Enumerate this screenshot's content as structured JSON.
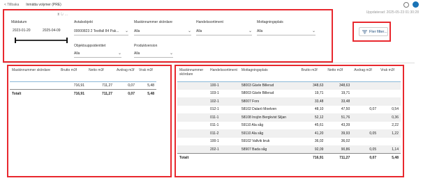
{
  "topbar": {
    "back_label": "< Tillbaka",
    "title": "Inmätta volymer (PRE)"
  },
  "updated": "Uppdaterad: 2025-05-23 01:30:28",
  "filters": {
    "toolbar": "⧗  ↻  …",
    "matdatum": {
      "label": "Mätdatum",
      "from": "2023-01-20",
      "to": "2025-04-09"
    },
    "avtalsobjekt": {
      "label": "Avtalsobjekt",
      "value": "00000823 2 Testfall 84 Pak..."
    },
    "maskinnummer": {
      "label": "Maskinnummer skördare",
      "value": "Alla"
    },
    "handelssortiment": {
      "label": "Handelssortiment",
      "value": "Alla"
    },
    "mottagningsplats": {
      "label": "Mottagningsplats",
      "value": "Alla"
    },
    "objektsuppsidentitet": {
      "label": "Objektsuppsidentitet",
      "value": "Alla"
    },
    "produktversion": {
      "label": "Produktversion",
      "value": "Alla"
    }
  },
  "filter_button": {
    "label": "Fler filter..."
  },
  "left_table": {
    "headers": [
      "Maskinnummer skördare",
      "Brutto m3f",
      "Netto m3f",
      "Avdrag m3f",
      "Vrak m3f"
    ],
    "rows": [
      [
        "",
        "716,91",
        "711,27",
        "0,07",
        "5,48"
      ]
    ],
    "total": [
      "Totalt",
      "716,91",
      "711,27",
      "0,07",
      "5,48"
    ]
  },
  "right_table": {
    "headers": [
      "Maskinnummer skördare",
      "Handelssortiment",
      "Mottagningsplats",
      "Brutto m3f",
      "Netto m3f",
      "Avdrag m3f",
      "Vrak m3f"
    ],
    "rows": [
      [
        "",
        "100-1",
        "58003 Gävle Billerud",
        "348,63",
        "348,63",
        "",
        ""
      ],
      [
        "",
        "103-1",
        "58003 Gävle Billerud",
        "19,71",
        "19,71",
        "",
        ""
      ],
      [
        "",
        "102-1",
        "58007 Fors",
        "33,48",
        "33,48",
        "",
        ""
      ],
      [
        "",
        "012-1",
        "58102 Dalarö Moelven",
        "48,10",
        "47,50",
        "0,07",
        "0,54"
      ],
      [
        "",
        "011-1",
        "58108 Insjön Bergkvist Siljan",
        "52,12",
        "51,76",
        "",
        "0,36"
      ],
      [
        "",
        "011-1",
        "59110 Ala såg",
        "45,61",
        "43,39",
        "",
        "2,22"
      ],
      [
        "",
        "011-2",
        "59110 Ala såg",
        "41,20",
        "39,93",
        "0,05",
        "1,22"
      ],
      [
        "",
        "100-1",
        "59102 Vallvik bruk",
        "36,02",
        "36,02",
        "",
        ""
      ],
      [
        "",
        "202-1",
        "58907 Bada såg",
        "92,09",
        "90,86",
        "0,05",
        "1,14"
      ]
    ],
    "total": [
      "Totalt",
      "",
      "",
      "716,91",
      "711,27",
      "0,07",
      "5,48"
    ]
  }
}
